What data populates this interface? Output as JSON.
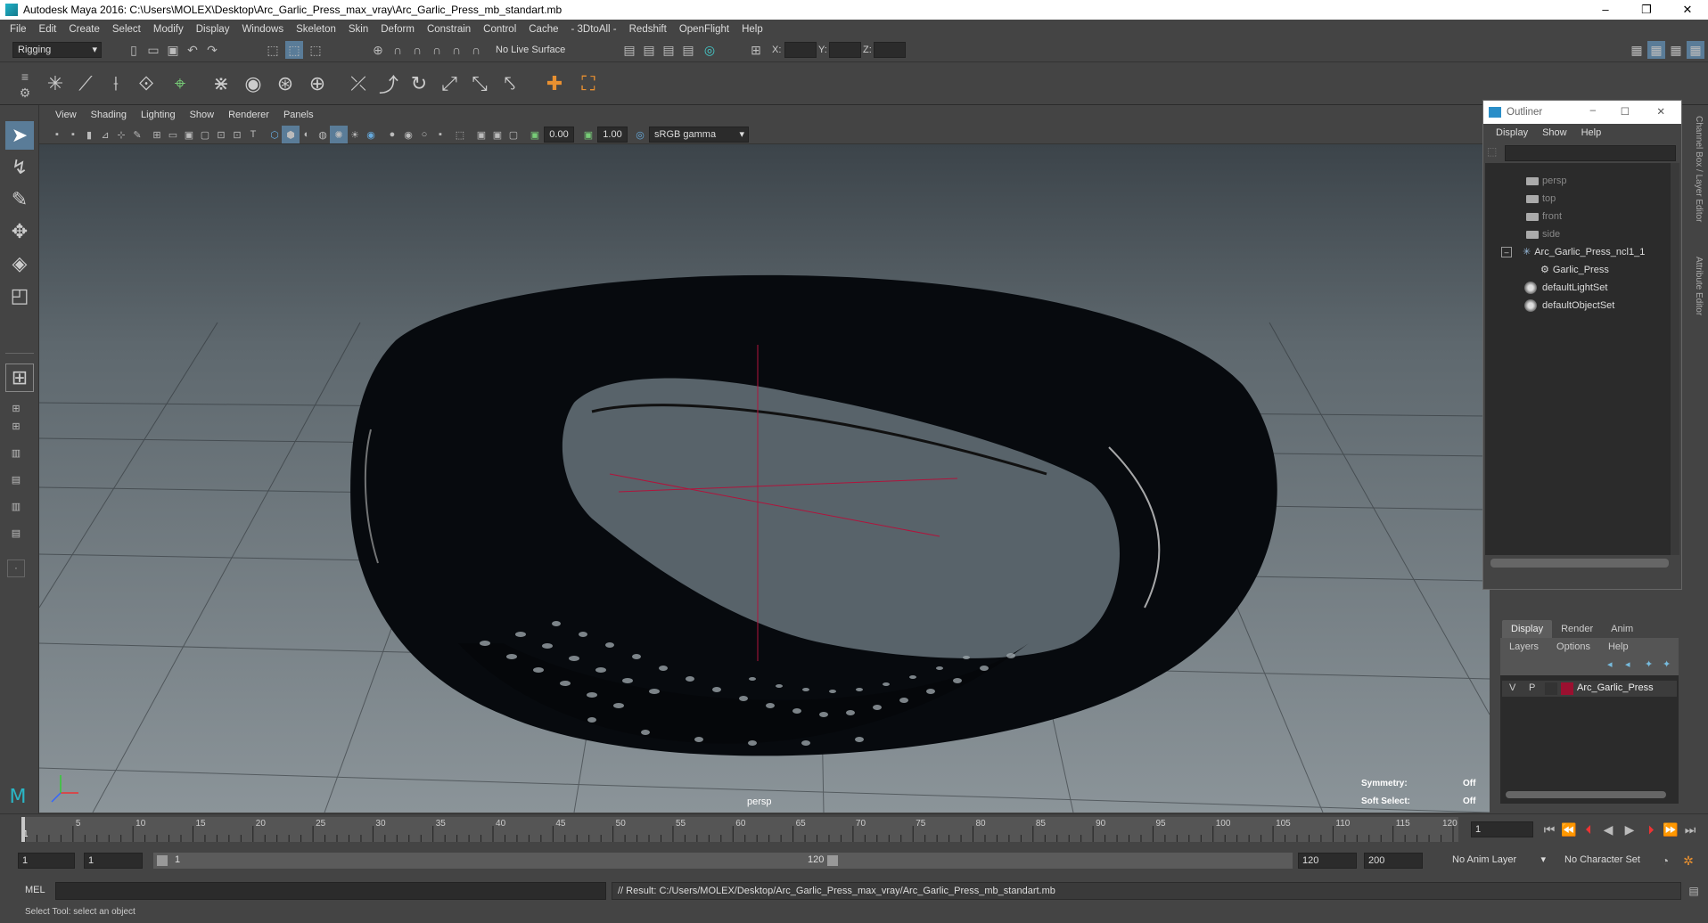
{
  "window": {
    "title": "Autodesk Maya 2016: C:\\Users\\MOLEX\\Desktop\\Arc_Garlic_Press_max_vray\\Arc_Garlic_Press_mb_standart.mb"
  },
  "menu": [
    "File",
    "Edit",
    "Create",
    "Select",
    "Modify",
    "Display",
    "Windows",
    "Skeleton",
    "Skin",
    "Deform",
    "Constrain",
    "Control",
    "Cache",
    "- 3DtoAll -",
    "Redshift",
    "OpenFlight",
    "Help"
  ],
  "status": {
    "mode": "Rigging",
    "live_surface": "No Live Surface",
    "x_label": "X:",
    "y_label": "Y:",
    "z_label": "Z:"
  },
  "viewport": {
    "menu": [
      "View",
      "Shading",
      "Lighting",
      "Show",
      "Renderer",
      "Panels"
    ],
    "field_a": "0.00",
    "field_b": "1.00",
    "color_space": "sRGB gamma",
    "camera_label": "persp",
    "symmetry_label": "Symmetry:",
    "symmetry_value": "Off",
    "soft_select_label": "Soft Select:",
    "soft_select_value": "Off"
  },
  "outliner": {
    "title": "Outliner",
    "menu": [
      "Display",
      "Show",
      "Help"
    ],
    "items": [
      "persp",
      "top",
      "front",
      "side",
      "Arc_Garlic_Press_ncl1_1",
      "Garlic_Press",
      "defaultLightSet",
      "defaultObjectSet"
    ]
  },
  "layer_editor": {
    "tabs": [
      "Display",
      "Render",
      "Anim"
    ],
    "menu": [
      "Layers",
      "Options",
      "Help"
    ],
    "layer": {
      "v": "V",
      "p": "P",
      "name": "Arc_Garlic_Press",
      "color": "#9b1030"
    }
  },
  "side_tabs": [
    "Channel Box / Layer Editor",
    "Attribute Editor"
  ],
  "timeline": {
    "ticks": [
      "5",
      "10",
      "15",
      "20",
      "25",
      "30",
      "35",
      "40",
      "45",
      "50",
      "55",
      "60",
      "65",
      "70",
      "75",
      "80",
      "85",
      "90",
      "95",
      "100",
      "105",
      "110",
      "115",
      "120"
    ],
    "start_tick": "1",
    "current_frame": "1"
  },
  "range": {
    "start": "1",
    "playback_start": "1",
    "slider_start": "1",
    "slider_end": "120",
    "playback_end": "120",
    "end": "200",
    "anim_layer": "No Anim Layer",
    "character_set": "No Character Set"
  },
  "command": {
    "lang": "MEL",
    "result": "// Result: C:/Users/MOLEX/Desktop/Arc_Garlic_Press_max_vray/Arc_Garlic_Press_mb_standart.mb"
  },
  "help": {
    "text": "Select Tool: select an object"
  }
}
